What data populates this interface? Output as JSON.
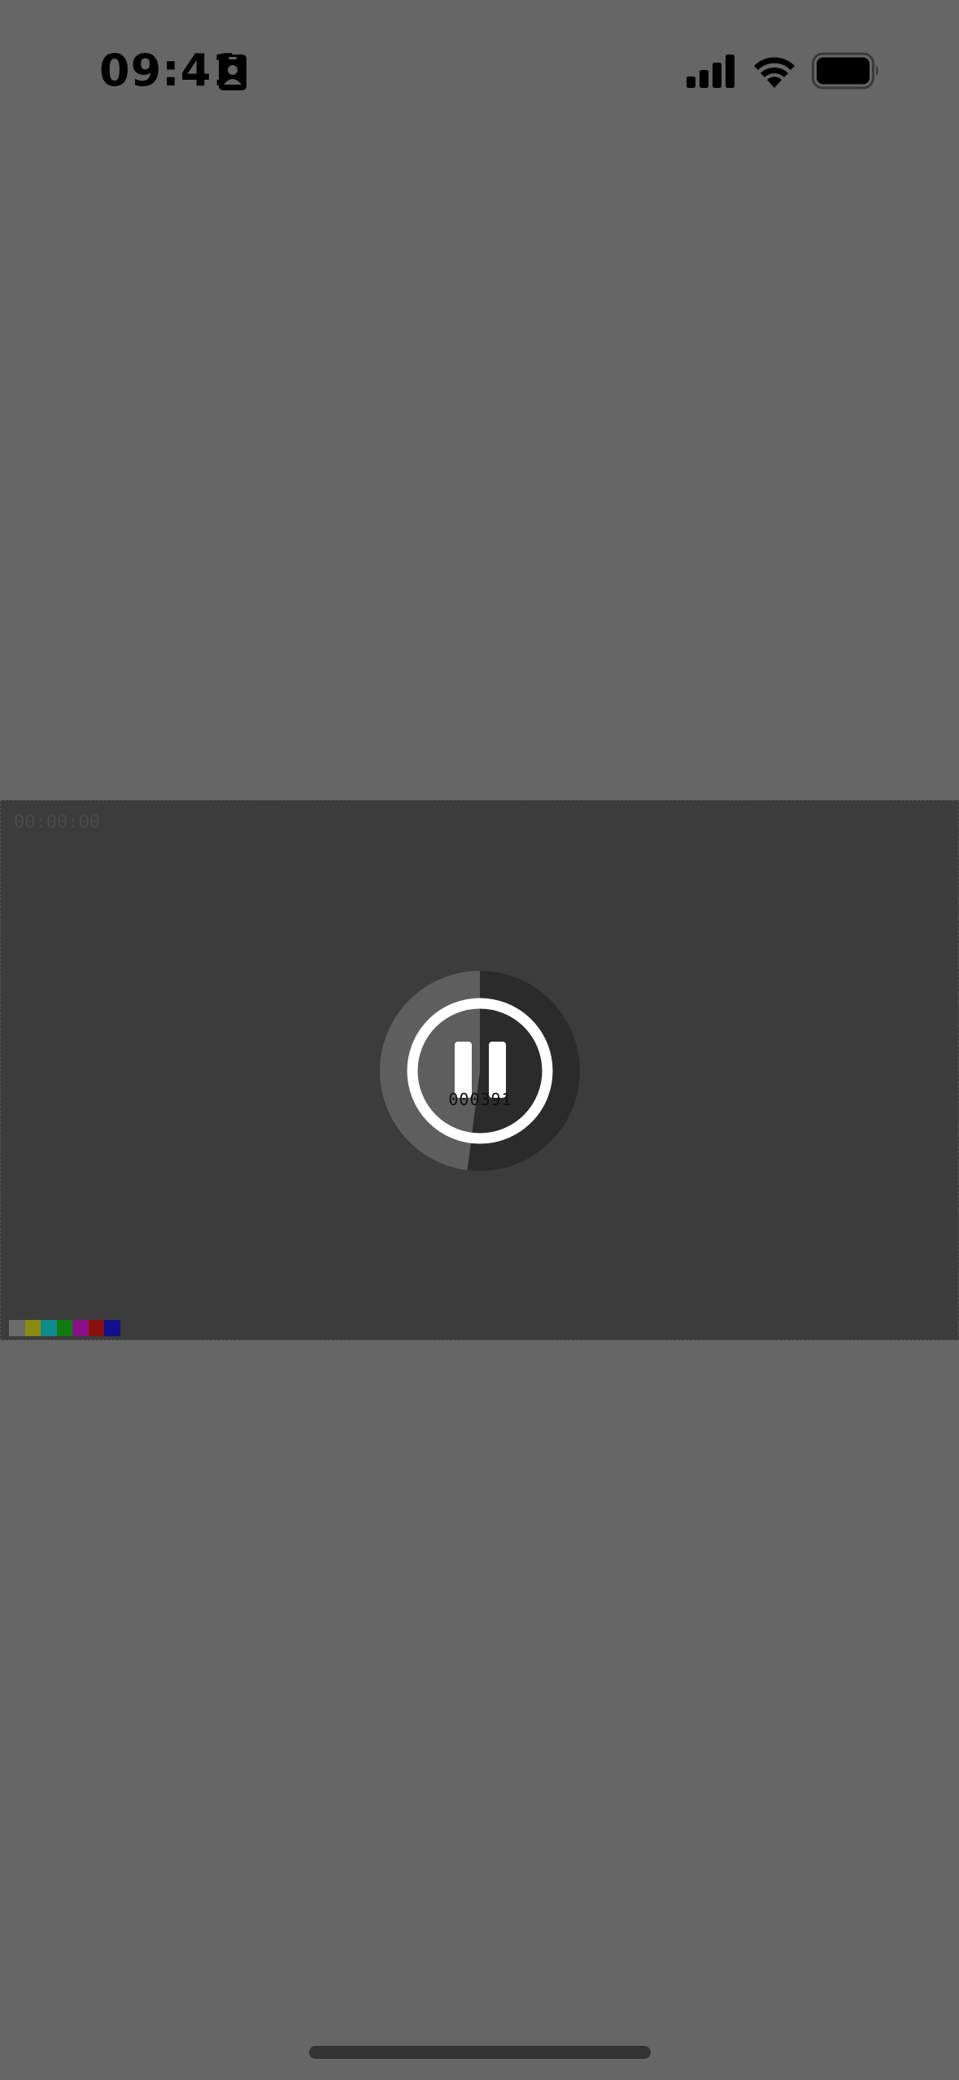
{
  "status_bar": {
    "time": "09:41"
  },
  "video": {
    "timestamp": "00:00:00",
    "frame_counter": "000391",
    "playback_progress": 0.52,
    "control_icon": "pause-icon",
    "color_bars": [
      "#6b6b6b",
      "#8a8a10",
      "#108a8a",
      "#107a10",
      "#8a108a",
      "#8a1010",
      "#10108a"
    ]
  },
  "colors": {
    "background": "#666666",
    "video_background": "#3c3c3c",
    "control_ring": "#ffffff",
    "progress_elapsed": "#2b2b2b",
    "progress_remaining": "#5e5e5e"
  }
}
